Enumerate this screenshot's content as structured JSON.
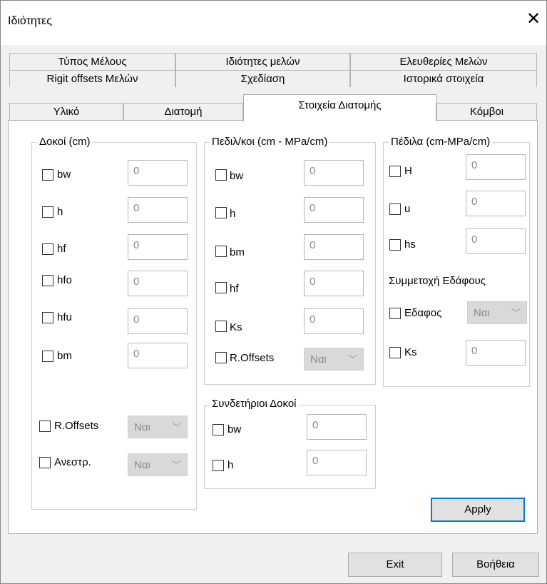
{
  "window": {
    "title": "Ιδιότητες",
    "close_glyph": "✕"
  },
  "tabs": {
    "row1": [
      "Τύπος Μέλους",
      "Ιδιότητες μελών",
      "Ελευθερίες Μελών"
    ],
    "row2": [
      "Rigit offsets Μελών",
      "Σχεδίαση",
      "Ιστορικά στοιχεία"
    ],
    "row3": [
      "Υλικό",
      "Διατομή",
      "Στοιχεία Διατομής",
      "Κόμβοι"
    ],
    "active": "Στοιχεία Διατομής"
  },
  "beams": {
    "title": "Δοκοί (cm)",
    "rows": [
      {
        "label": "bw",
        "value": "0"
      },
      {
        "label": "h",
        "value": "0"
      },
      {
        "label": "hf",
        "value": "0"
      },
      {
        "label": "hfo",
        "value": "0"
      },
      {
        "label": "hfu",
        "value": "0"
      },
      {
        "label": "bm",
        "value": "0"
      }
    ],
    "roffsets": {
      "label": "R.Offsets",
      "value": "Ναι"
    },
    "inverted": {
      "label": "Ανεστρ.",
      "value": "Ναι"
    }
  },
  "pedilokoi": {
    "title": "Πεδιλ/κοι (cm - MPa/cm)",
    "rows": [
      {
        "label": "bw",
        "value": "0"
      },
      {
        "label": "h",
        "value": "0"
      },
      {
        "label": "bm",
        "value": "0"
      },
      {
        "label": "hf",
        "value": "0"
      },
      {
        "label": "Ks",
        "value": "0"
      }
    ],
    "roffsets": {
      "label": "R.Offsets",
      "value": "Ναι"
    }
  },
  "tie_beams": {
    "title": "Συνδετήριοι Δοκοί",
    "rows": [
      {
        "label": "bw",
        "value": "0"
      },
      {
        "label": "h",
        "value": "0"
      }
    ]
  },
  "footings": {
    "title": "Πέδιλα (cm-MPa/cm)",
    "rows": [
      {
        "label": "H",
        "value": "0"
      },
      {
        "label": "u",
        "value": "0"
      },
      {
        "label": "hs",
        "value": "0"
      }
    ],
    "soil_heading": "Συμμετοχή Εδάφους",
    "soil": {
      "label": "Εδαφος",
      "value": "Ναι"
    },
    "ks": {
      "label": "Ks",
      "value": "0"
    }
  },
  "buttons": {
    "apply": "Apply",
    "exit": "Exit",
    "help": "Βοήθεια"
  }
}
